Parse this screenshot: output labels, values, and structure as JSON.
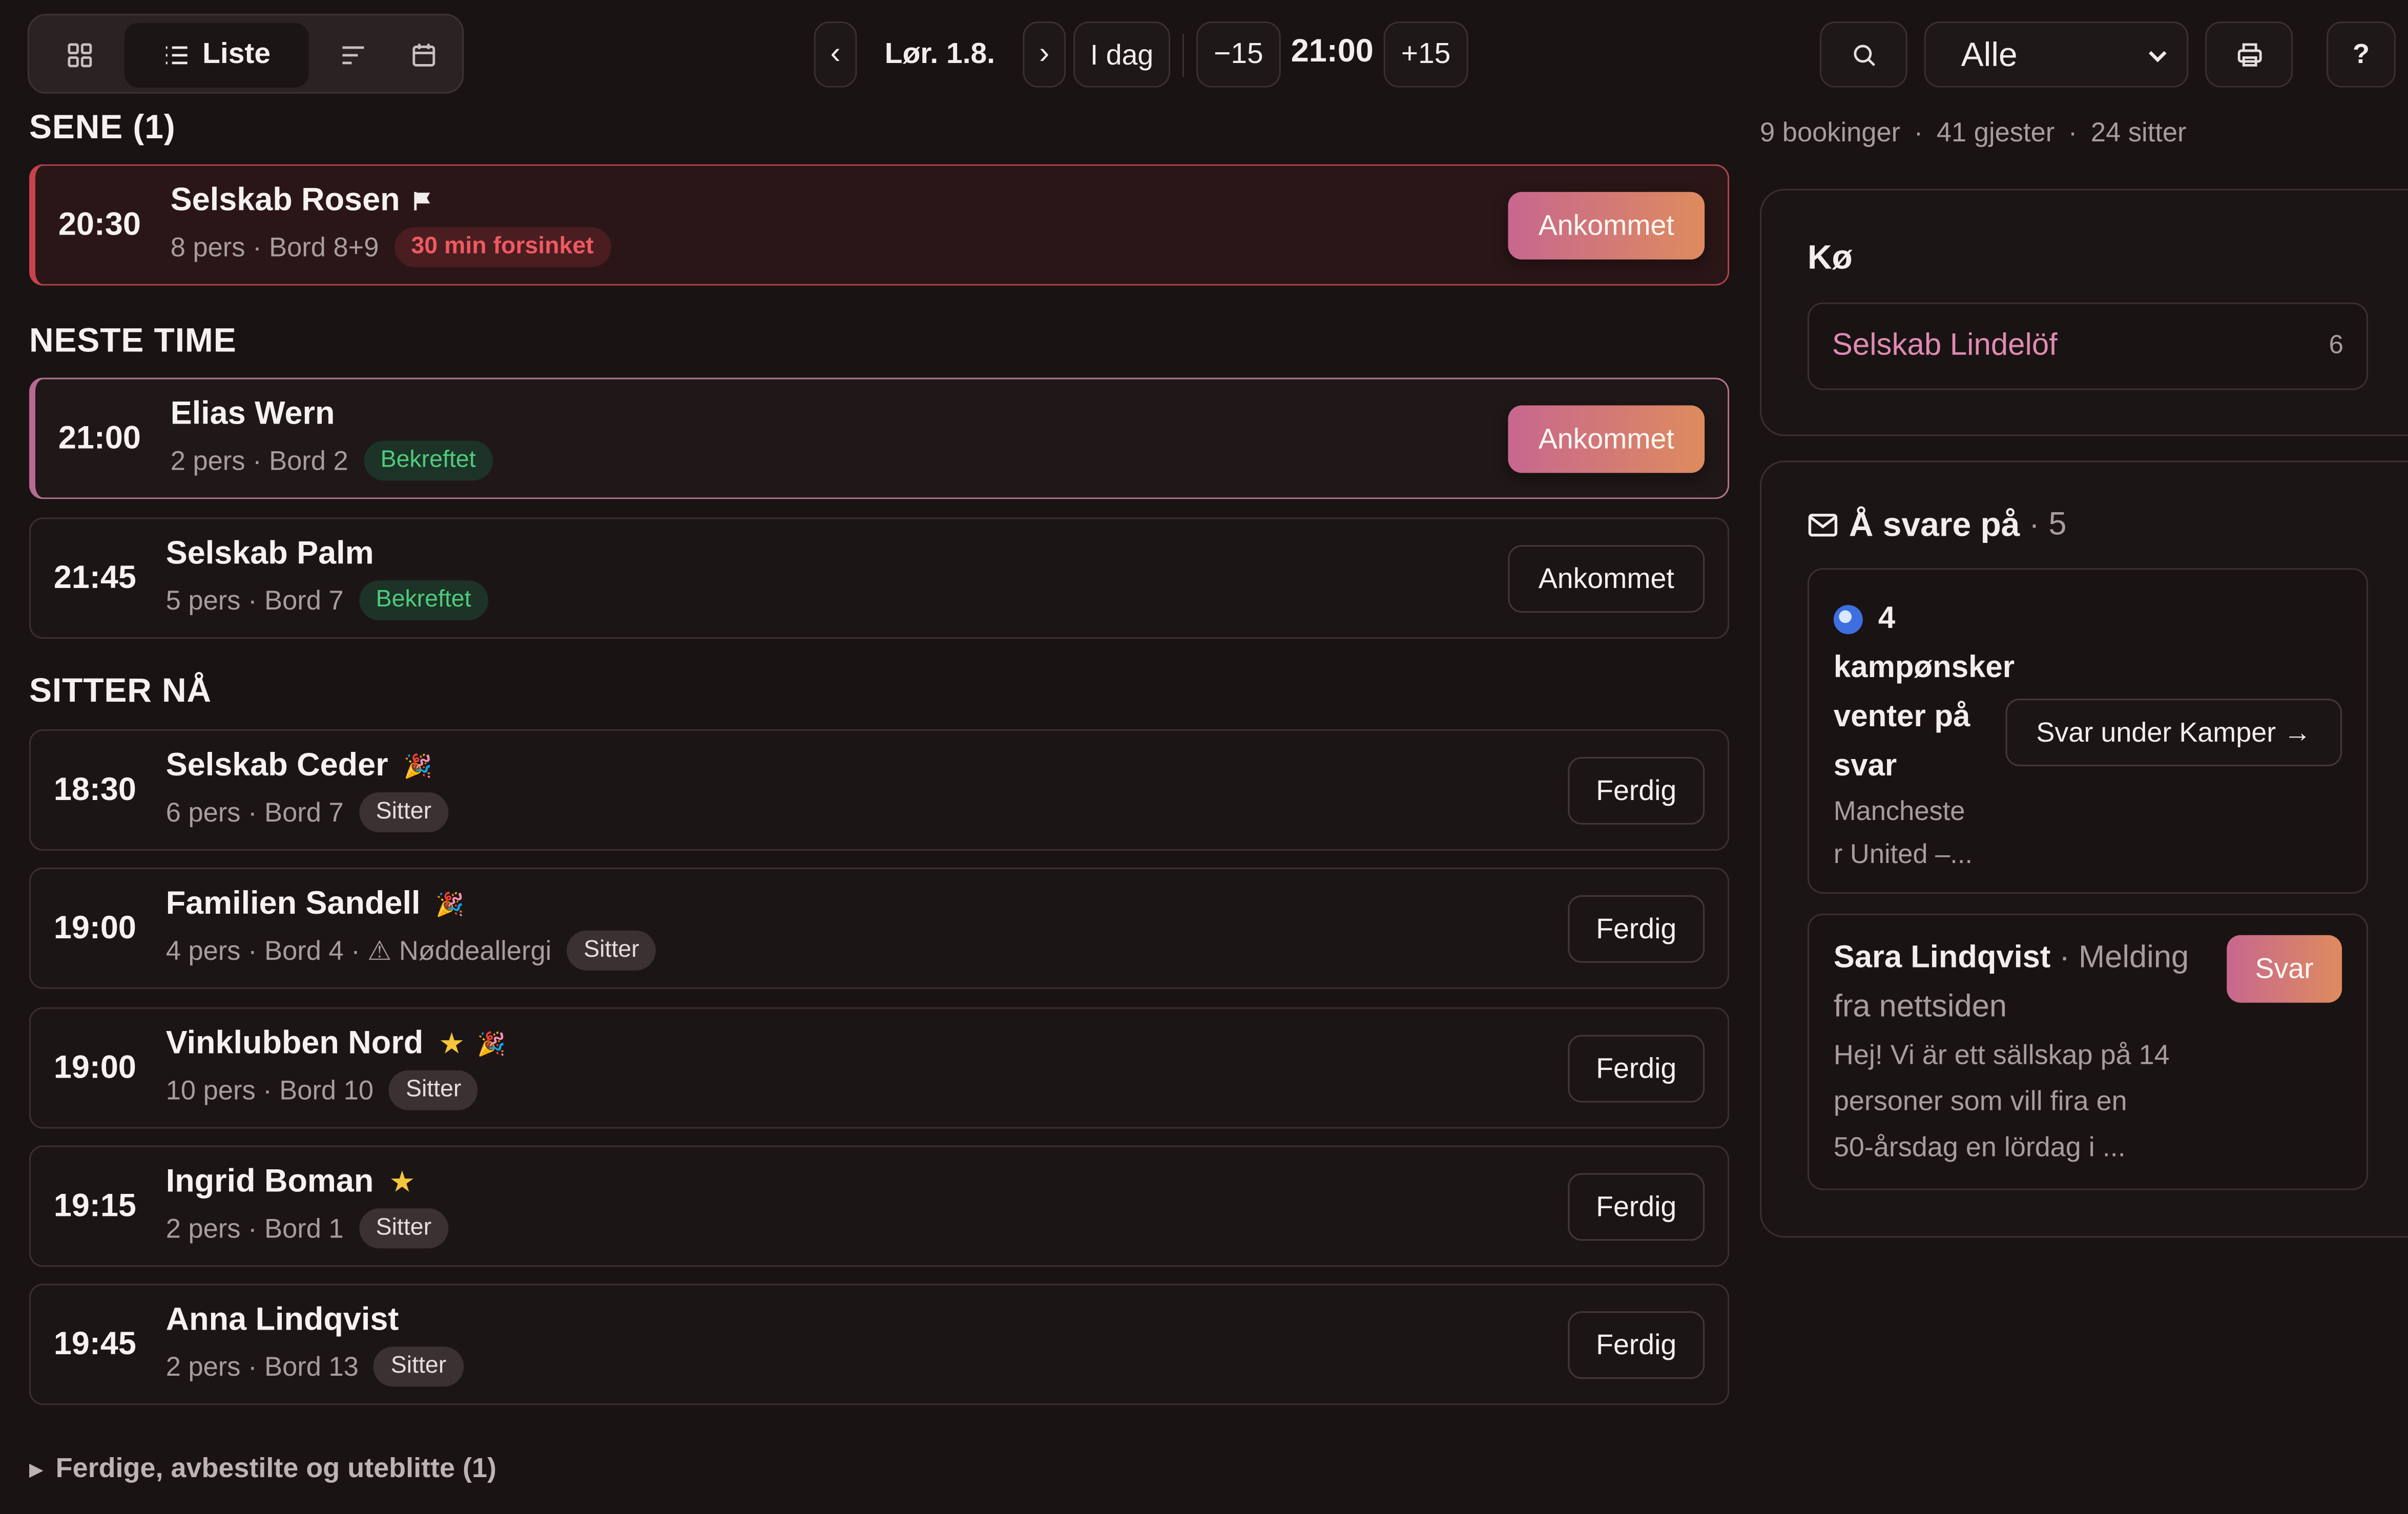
{
  "toolbar": {
    "views": [
      {
        "icon": "grid-icon",
        "label": ""
      },
      {
        "icon": "list-icon",
        "label": "Liste"
      },
      {
        "icon": "timeline-icon",
        "label": ""
      },
      {
        "icon": "calendar-icon",
        "label": ""
      }
    ],
    "prev_day": "‹",
    "date_label": "Lør. 1.8.",
    "next_day": "›",
    "today_label": "I dag",
    "minus_label": "−15",
    "time_label": "21:00",
    "plus_label": "+15",
    "filter_selected": "Alle",
    "help_label": "?"
  },
  "summary": {
    "bookings": "9 bookinger",
    "sep1": "·",
    "guests": "41 gjester",
    "sep2": "·",
    "seated": "24 sitter"
  },
  "sections": {
    "late": "SENE (1)",
    "next": "NESTE TIME",
    "seated": "SITTER NÅ"
  },
  "late": [
    {
      "time": "20:30",
      "name": "Selskab Rosen",
      "meta": "8 pers · Bord 8+9",
      "badge": "30 min forsinket",
      "action": "Ankommet"
    }
  ],
  "next": [
    {
      "time": "21:00",
      "name": "Elias Wern",
      "meta": "2 pers · Bord 2",
      "badge": "Bekreftet",
      "action": "Ankommet"
    },
    {
      "time": "21:45",
      "name": "Selskab Palm",
      "meta": "5 pers · Bord 7",
      "badge": "Bekreftet",
      "action": "Ankommet"
    }
  ],
  "seated": [
    {
      "time": "18:30",
      "name": "Selskab Ceder",
      "meta": "6 pers · Bord 7",
      "badge": "Sitter",
      "action": "Ferdig"
    },
    {
      "time": "19:00",
      "name": "Familien Sandell",
      "meta": "4 pers · Bord 4 · ⚠ Nøddeallergi",
      "badge": "Sitter",
      "action": "Ferdig"
    },
    {
      "time": "19:00",
      "name": "Vinklubben Nord",
      "meta": "10 pers · Bord 10",
      "badge": "Sitter",
      "action": "Ferdig"
    },
    {
      "time": "19:15",
      "name": "Ingrid Boman",
      "meta": "2 pers · Bord 1",
      "badge": "Sitter",
      "action": "Ferdig"
    },
    {
      "time": "19:45",
      "name": "Anna Lindqvist",
      "meta": "2 pers · Bord 13",
      "badge": "Sitter",
      "action": "Ferdig"
    }
  ],
  "footer": {
    "arrow": "▶",
    "label": "Ferdige, avbestilte og uteblitte (1)"
  },
  "queue": {
    "title": "Kø",
    "item_name": "Selskab Lindelöf",
    "item_count": "6"
  },
  "reply": {
    "title": "Å svare på",
    "sep": "·",
    "count": "5",
    "matches": {
      "line1": "4",
      "line2": "kampønsker",
      "line3": "venter på",
      "line4": "svar",
      "sub1": "Mancheste",
      "sub2": "r United –...",
      "button": "Svar under Kamper →"
    },
    "message": {
      "sender": "Sara Lindqvist",
      "sep": "·",
      "source1": "Melding",
      "source2": "fra nettsiden",
      "line1": "Hej! Vi är ett sällskap på 14",
      "line2": "personer som vill fira en",
      "line3": "50-årsdag en lördag i ...",
      "button": "Svar"
    }
  },
  "colors": {
    "background": "#1a1314",
    "accent_gradient_start": "#c7678f",
    "accent_gradient_end": "#de8b5e",
    "late_border": "#c8424b",
    "confirmed_green": "#4fcb7d",
    "queue_name": "#e08bb3"
  }
}
